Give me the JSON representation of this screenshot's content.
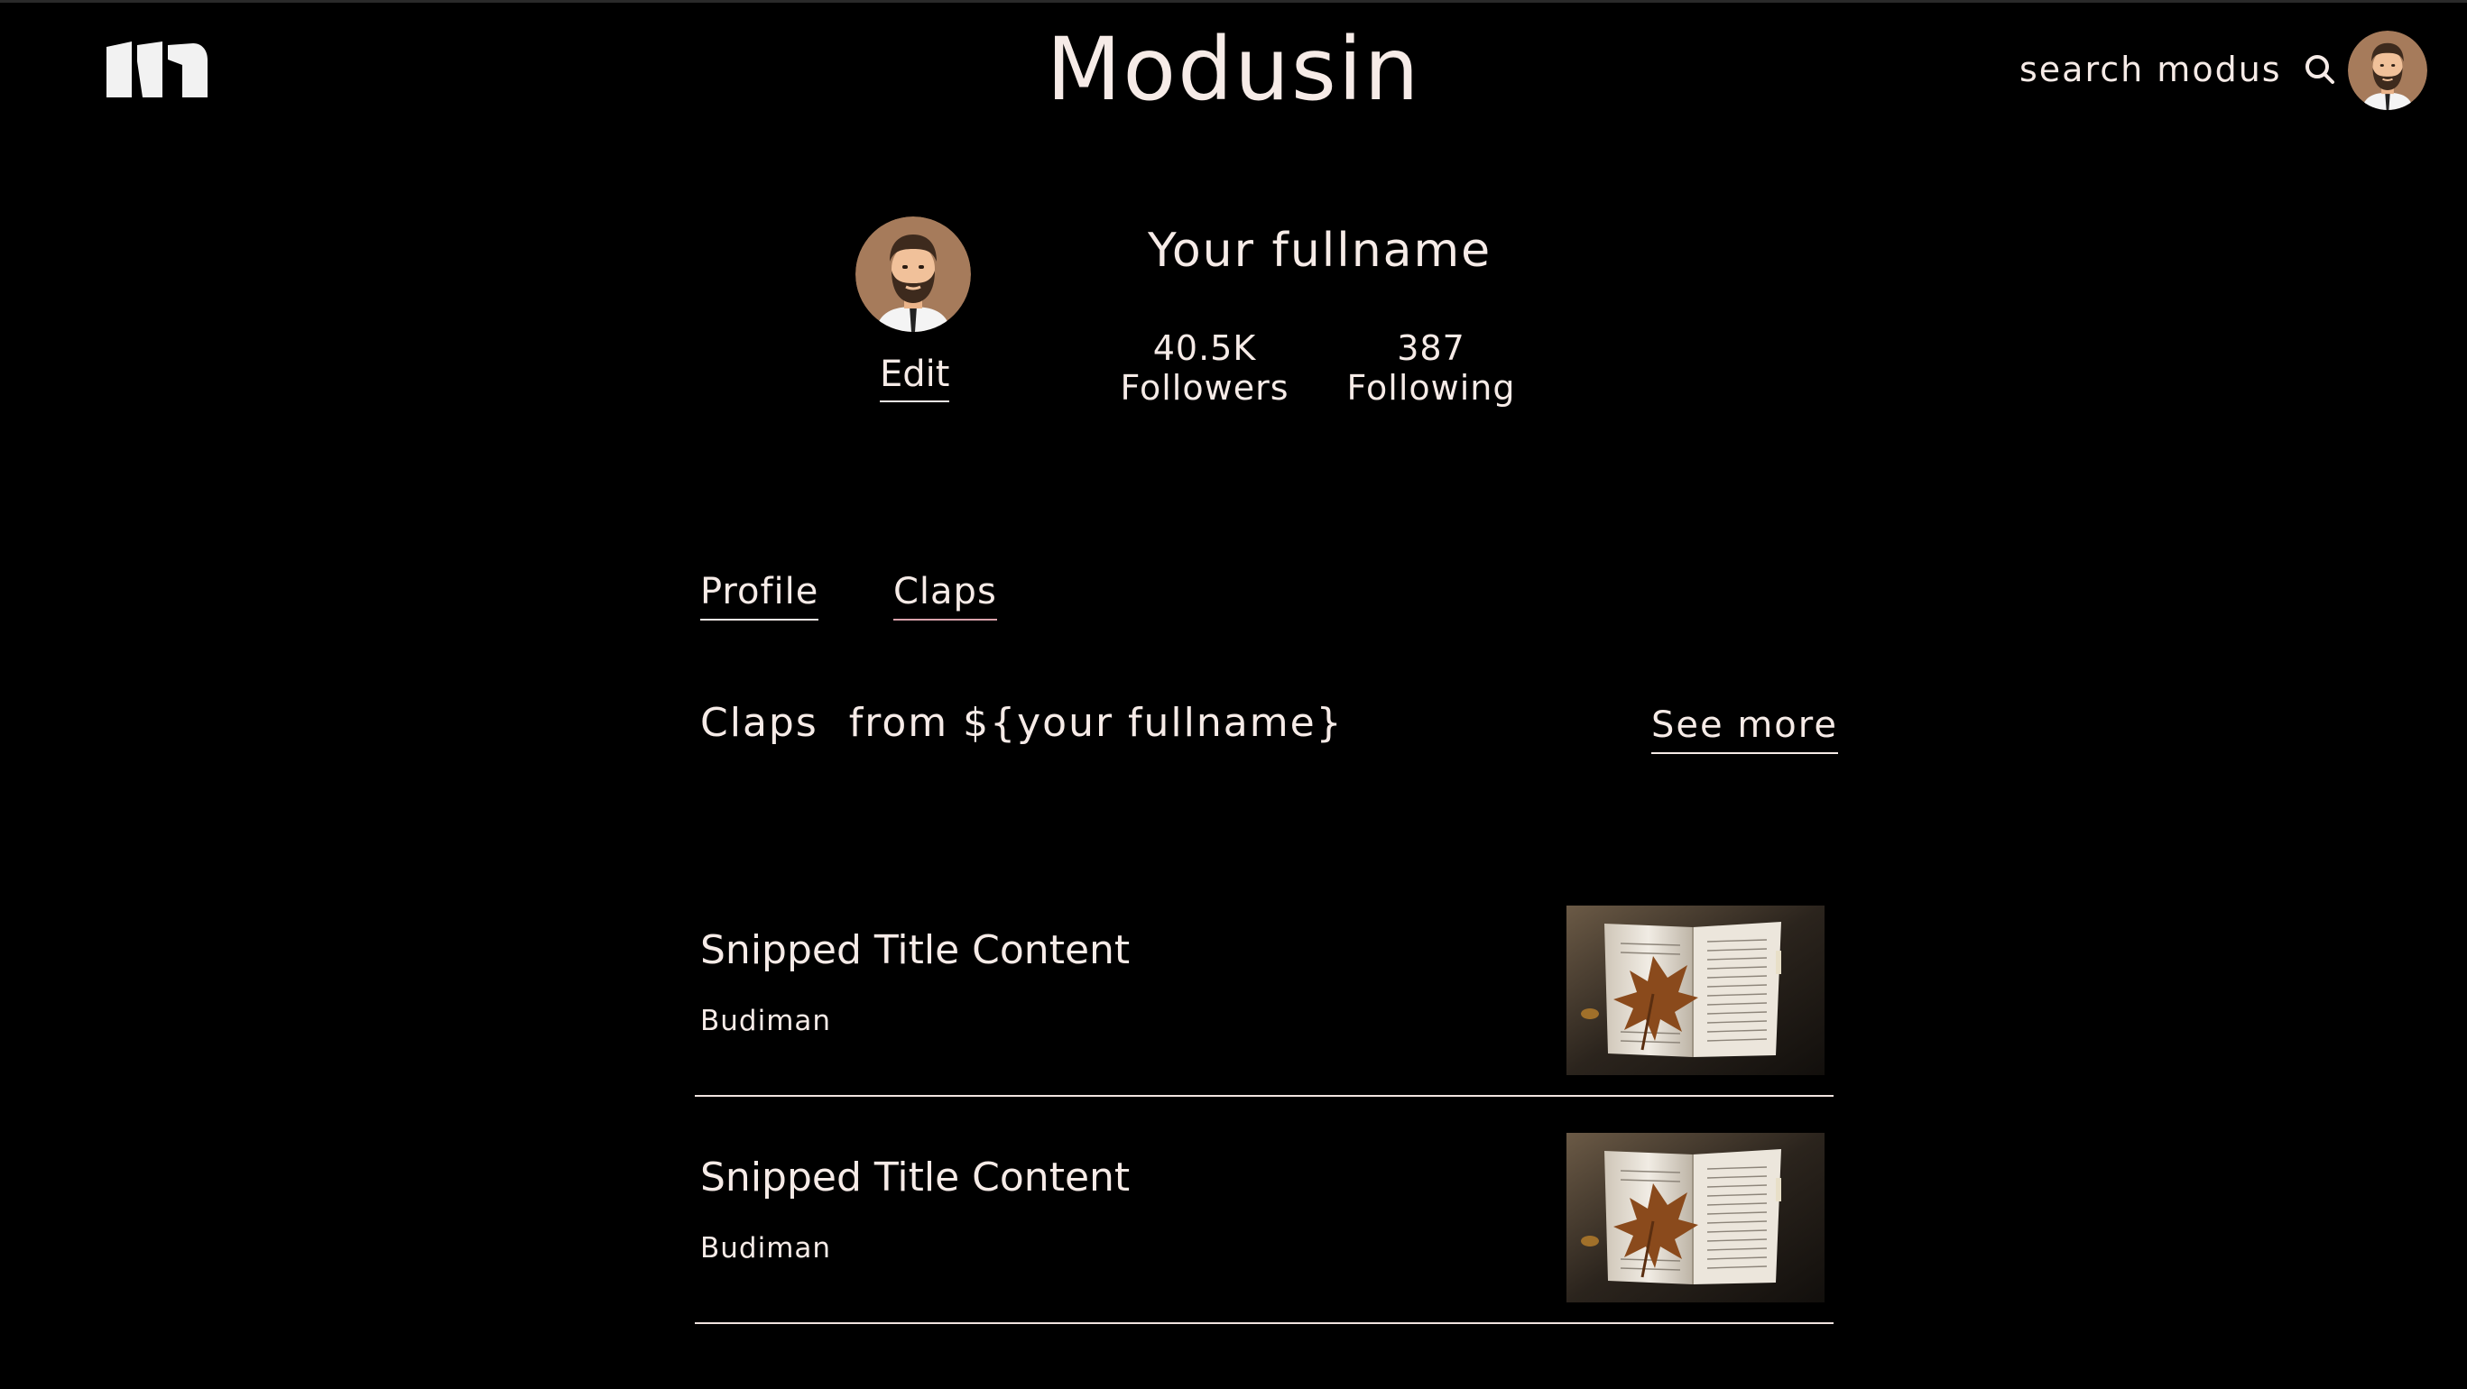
{
  "header": {
    "brand": "Modusin",
    "search_label": "search modus"
  },
  "profile": {
    "fullname": "Your fullname",
    "edit_label": "Edit",
    "followers_count": "40.5K",
    "followers_label": "Followers",
    "following_count": "387",
    "following_label": "Following"
  },
  "tabs": [
    {
      "label": "Profile",
      "active": false
    },
    {
      "label": "Claps",
      "active": true
    }
  ],
  "section": {
    "title_word": "Claps",
    "title_rest": "from ${your fullname}",
    "see_more": "See more"
  },
  "articles": [
    {
      "title": "Snipped Title Content",
      "author": "Budiman",
      "thumbnail": "open-book-with-maple-leaf"
    },
    {
      "title": "Snipped Title Content",
      "author": "Budiman",
      "thumbnail": "open-book-with-maple-leaf"
    }
  ],
  "colors": {
    "background": "#000000",
    "text": "#f6ebe7",
    "avatar_bg": "#a67b5b",
    "active_tab_underline": "#d9a2ab"
  }
}
